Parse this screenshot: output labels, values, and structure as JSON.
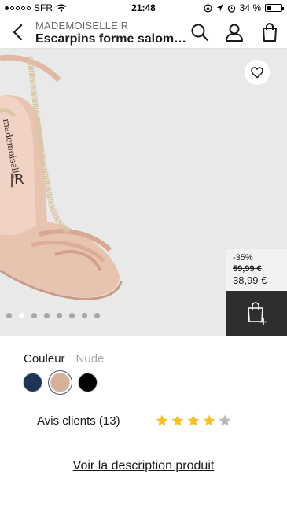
{
  "status_bar": {
    "carrier": "SFR",
    "time": "21:48",
    "battery": "34 %"
  },
  "header": {
    "brand": "MADEMOISELLE R",
    "title": "Escarpins forme salomé..."
  },
  "gallery": {
    "pages": 8,
    "active_page": 1
  },
  "price": {
    "discount": "-35%",
    "old_price": "59,99 €",
    "new_price": "38,99 €"
  },
  "color": {
    "label": "Couleur",
    "selected": "Nude",
    "swatches": [
      "#1e3558",
      "#d8b09a",
      "#000000"
    ]
  },
  "reviews": {
    "label": "Avis clients (13)",
    "rating": 4,
    "max": 5
  },
  "description_link": "Voir la description produit"
}
